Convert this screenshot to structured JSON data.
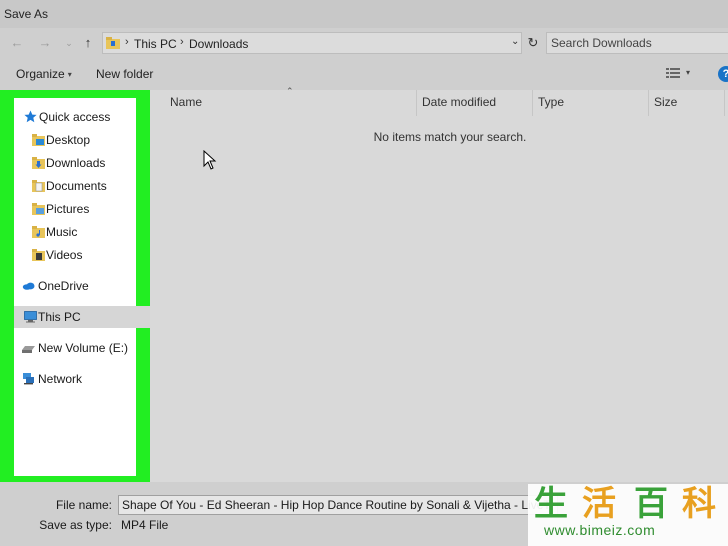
{
  "window": {
    "title": "Save As"
  },
  "address": {
    "breadcrumbs": [
      "This PC",
      "Downloads"
    ],
    "search_placeholder": "Search Downloads"
  },
  "toolbar": {
    "organize_label": "Organize",
    "new_folder_label": "New folder"
  },
  "sidebar": {
    "accent_color": "#22ee22",
    "items": [
      {
        "label": "Quick access",
        "icon": "star-icon"
      },
      {
        "label": "Desktop",
        "icon": "desktop-folder-icon"
      },
      {
        "label": "Downloads",
        "icon": "downloads-folder-icon"
      },
      {
        "label": "Documents",
        "icon": "documents-folder-icon"
      },
      {
        "label": "Pictures",
        "icon": "pictures-folder-icon"
      },
      {
        "label": "Music",
        "icon": "music-folder-icon"
      },
      {
        "label": "Videos",
        "icon": "videos-folder-icon"
      },
      {
        "label": "OneDrive",
        "icon": "cloud-icon"
      },
      {
        "label": "This PC",
        "icon": "computer-icon",
        "selected": true
      },
      {
        "label": "New Volume (E:)",
        "icon": "drive-icon"
      },
      {
        "label": "Network",
        "icon": "network-icon"
      }
    ]
  },
  "file_list": {
    "columns": [
      "Name",
      "Date modified",
      "Type",
      "Size"
    ],
    "empty_message": "No items match your search."
  },
  "bottom": {
    "file_name_label": "File name:",
    "file_name_value": "Shape Of You - Ed Sheeran - Hip Hop Dance Routine by Sonali & Vijetha - LiveT",
    "save_type_label": "Save as type:",
    "save_type_value": "MP4 File"
  },
  "watermark": {
    "chars": [
      "生",
      "活",
      "百",
      "科"
    ],
    "url": "www.bimeiz.com"
  }
}
